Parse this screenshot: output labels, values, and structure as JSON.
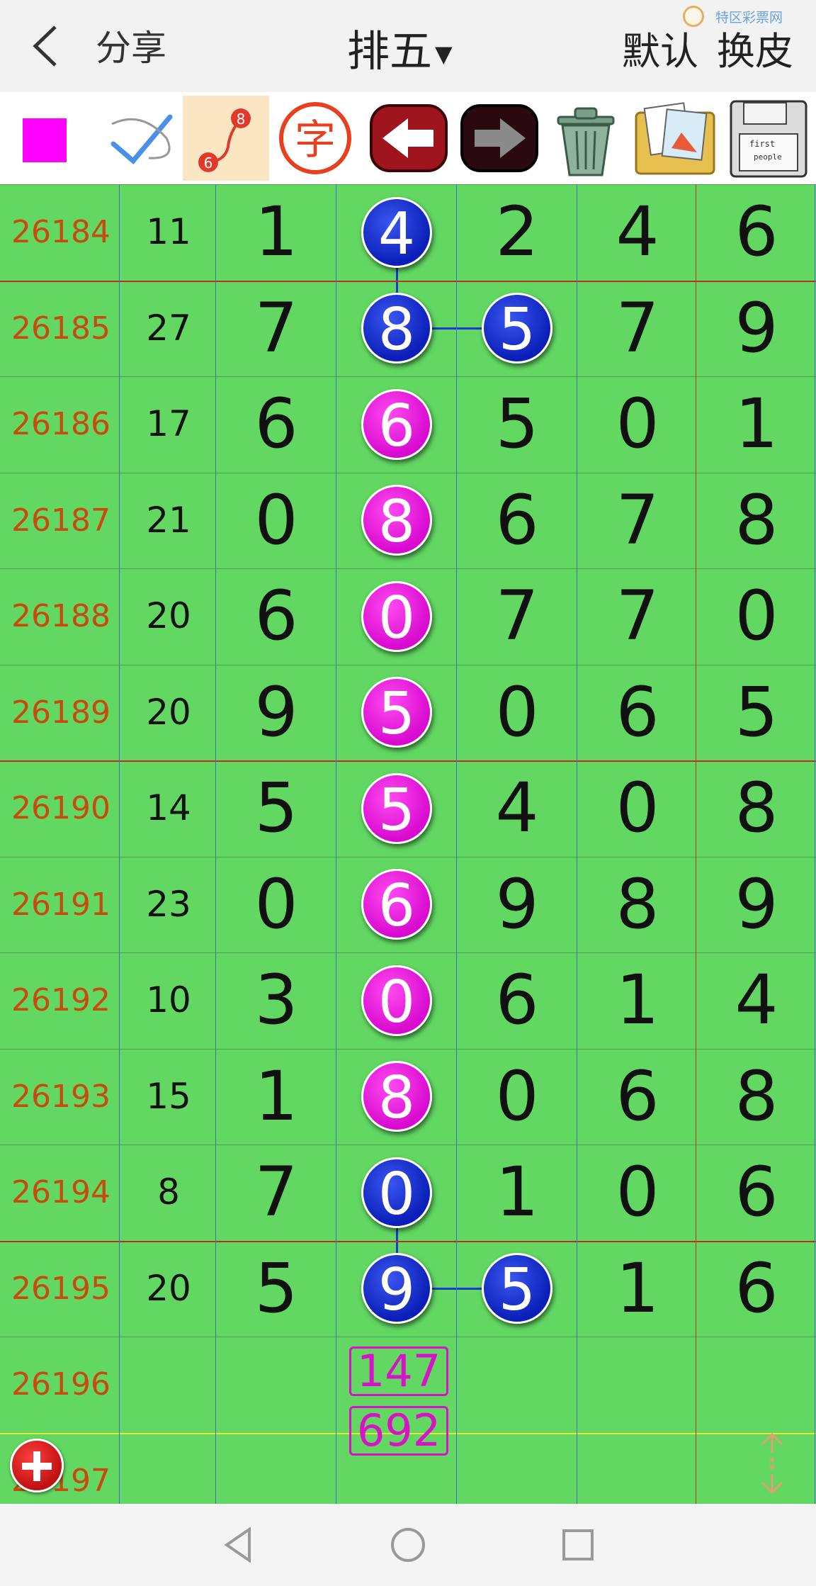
{
  "header": {
    "share_label": "分享",
    "title": "排五",
    "default_label": "默认",
    "skin_label": "换皮",
    "watermark": "特区彩票网"
  },
  "toolbar": {
    "tools": [
      {
        "name": "color-swatch",
        "color": "#ff00ff"
      },
      {
        "name": "check-draw-icon"
      },
      {
        "name": "connect-line-icon",
        "labels": [
          "8",
          "6"
        ]
      },
      {
        "name": "text-icon",
        "label": "字"
      },
      {
        "name": "undo-arrow-icon"
      },
      {
        "name": "redo-arrow-icon"
      },
      {
        "name": "trash-icon"
      },
      {
        "name": "gallery-icon"
      },
      {
        "name": "save-disk-icon",
        "labels": [
          "first",
          "people"
        ]
      }
    ]
  },
  "table": {
    "rows": [
      {
        "issue": "26184",
        "sum": "11",
        "d": [
          "1",
          "4",
          "2",
          "4",
          "6"
        ]
      },
      {
        "issue": "26185",
        "sum": "27",
        "d": [
          "7",
          "8",
          "5",
          "7",
          "9"
        ]
      },
      {
        "issue": "26186",
        "sum": "17",
        "d": [
          "6",
          "6",
          "5",
          "0",
          "1"
        ]
      },
      {
        "issue": "26187",
        "sum": "21",
        "d": [
          "0",
          "8",
          "6",
          "7",
          "8"
        ]
      },
      {
        "issue": "26188",
        "sum": "20",
        "d": [
          "6",
          "0",
          "7",
          "7",
          "0"
        ]
      },
      {
        "issue": "26189",
        "sum": "20",
        "d": [
          "9",
          "5",
          "0",
          "6",
          "5"
        ]
      },
      {
        "issue": "26190",
        "sum": "14",
        "d": [
          "5",
          "5",
          "4",
          "0",
          "8"
        ]
      },
      {
        "issue": "26191",
        "sum": "23",
        "d": [
          "0",
          "6",
          "9",
          "8",
          "9"
        ]
      },
      {
        "issue": "26192",
        "sum": "10",
        "d": [
          "3",
          "0",
          "6",
          "1",
          "4"
        ]
      },
      {
        "issue": "26193",
        "sum": "15",
        "d": [
          "1",
          "8",
          "0",
          "6",
          "8"
        ]
      },
      {
        "issue": "26194",
        "sum": "8",
        "d": [
          "7",
          "0",
          "1",
          "0",
          "6"
        ]
      },
      {
        "issue": "26195",
        "sum": "20",
        "d": [
          "5",
          "9",
          "5",
          "1",
          "6"
        ]
      },
      {
        "issue": "26196",
        "sum": "",
        "d": [
          "",
          "",
          "",
          "",
          ""
        ]
      },
      {
        "issue": "26197",
        "sum": "",
        "d": [
          "",
          "",
          "",
          "",
          ""
        ]
      }
    ],
    "balls": [
      {
        "row": 0,
        "col": 1,
        "color": "blue"
      },
      {
        "row": 1,
        "col": 1,
        "color": "blue"
      },
      {
        "row": 1,
        "col": 2,
        "color": "blue"
      },
      {
        "row": 2,
        "col": 1,
        "color": "pink"
      },
      {
        "row": 3,
        "col": 1,
        "color": "pink"
      },
      {
        "row": 4,
        "col": 1,
        "color": "pink"
      },
      {
        "row": 5,
        "col": 1,
        "color": "pink"
      },
      {
        "row": 6,
        "col": 1,
        "color": "pink"
      },
      {
        "row": 7,
        "col": 1,
        "color": "pink"
      },
      {
        "row": 8,
        "col": 1,
        "color": "pink"
      },
      {
        "row": 9,
        "col": 1,
        "color": "pink"
      },
      {
        "row": 10,
        "col": 1,
        "color": "blue"
      },
      {
        "row": 11,
        "col": 1,
        "color": "blue"
      },
      {
        "row": 11,
        "col": 2,
        "color": "blue"
      }
    ],
    "predictions": [
      "147",
      "692"
    ]
  },
  "colors": {
    "grid_bg": "#62d862",
    "issue_text": "#c84a10",
    "ball_blue": "#0a1fb8",
    "ball_pink": "#d80ad0",
    "prediction": "#d812c8"
  }
}
